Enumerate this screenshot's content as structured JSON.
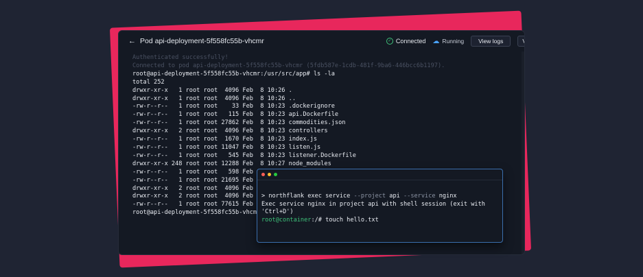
{
  "window": {
    "title": "Pod api-deployment-5f558fc55b-vhcmr",
    "status_connected": "Connected",
    "status_running": "Running",
    "view_logs_label": "View logs",
    "extra_button_label": "V"
  },
  "terminal": {
    "lines": [
      "Authenticated successfully!",
      "Connected to pod api-deployment-5f558fc55b-vhcmr (5fdb587e-1cdb-481f-9ba6-446bcc6b1197).",
      "root@api-deployment-5f558fc55b-vhcmr:/usr/src/app# ls -la",
      "total 252",
      "drwxr-xr-x   1 root root  4096 Feb  8 10:26 .",
      "drwxr-xr-x   1 root root  4096 Feb  8 10:26 ..",
      "-rw-r--r--   1 root root    33 Feb  8 10:23 .dockerignore",
      "-rw-r--r--   1 root root   115 Feb  8 10:23 api.Dockerfile",
      "-rw-r--r--   1 root root 27862 Feb  8 10:23 commodities.json",
      "drwxr-xr-x   2 root root  4096 Feb  8 10:23 controllers",
      "-rw-r--r--   1 root root  1670 Feb  8 10:23 index.js",
      "-rw-r--r--   1 root root 11047 Feb  8 10:23 listen.js",
      "-rw-r--r--   1 root root   545 Feb  8 10:23 listener.Dockerfile",
      "drwxr-xr-x 248 root root 12288 Feb  8 10:27 node_modules",
      "-rw-r--r--   1 root root   598 Feb  8",
      "-rw-r--r--   1 root root 21695 Feb  8",
      "drwxr-xr-x   2 root root  4096 Feb  8",
      "drwxr-xr-x   2 root root  4096 Feb  8",
      "-rw-r--r--   1 root root 77615 Feb  8",
      "root@api-deployment-5f558fc55b-vhcmr:/"
    ]
  },
  "popup": {
    "cmd_prefix": "> northflank exec service ",
    "cmd_flag_project": "--project",
    "cmd_project": " api ",
    "cmd_flag_service": "--service",
    "cmd_service": " nginx",
    "message": "Exec service nginx in project api with shell session (exit with 'Ctrl+D')",
    "prompt": "root@container",
    "prompt_rest": ":/# touch hello.txt"
  },
  "colors": {
    "accent_pink": "#e8275c",
    "connected_green": "#3ec27a",
    "running_blue": "#4aa3ff",
    "popup_border": "#3b6fae"
  },
  "icons": {
    "back": "arrow-left-icon",
    "connected": "check-circle-icon",
    "running": "cloud-icon"
  }
}
